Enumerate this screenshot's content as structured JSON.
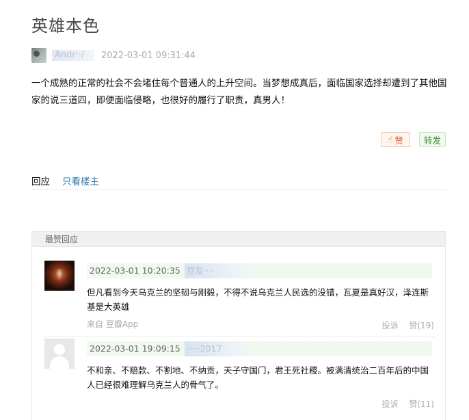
{
  "post": {
    "title": "英雄本色",
    "author_name": "Andr··/",
    "time": "2022-03-01 09:31:44",
    "body": "一个成熟的正常的社会不会堵住每个普通人的上升空间。当梦想成真后，面临国家选择却遭到了其他国家的说三道四，即便面临侵略，也很好的履行了职责，真男人！",
    "like_label": "赞",
    "share_label": "转发"
  },
  "tabs": {
    "all": "回应",
    "owner_only": "只看楼主"
  },
  "hot_replies": {
    "header": "最赞回应",
    "items": [
      {
        "time": "2022-03-01 10:20:35",
        "user": "豆友····",
        "text": "但凡看到今天乌克兰的坚韧与刚毅，不得不说乌克兰人民选的没错，瓦夏是真好汉，泽连斯基是大英雄",
        "source": "来自 豆瓣App",
        "report": "投诉",
        "likes": "赞(19)"
      },
      {
        "time": "2022-03-01 19:09:15",
        "user": "·····2017",
        "text": "不和亲、不赔款、不割地、不纳贡，天子守国门，君王死社稷。被满清统治二百年后的中国人已经很难理解乌克兰人的骨气了。",
        "source": "",
        "report": "投诉",
        "likes": "赞(11)"
      }
    ]
  },
  "colors": {
    "link": "#3377aa",
    "like_accent": "#e3643a",
    "share_accent": "#3d8b35",
    "meta_bg": "#f0f8ef"
  }
}
